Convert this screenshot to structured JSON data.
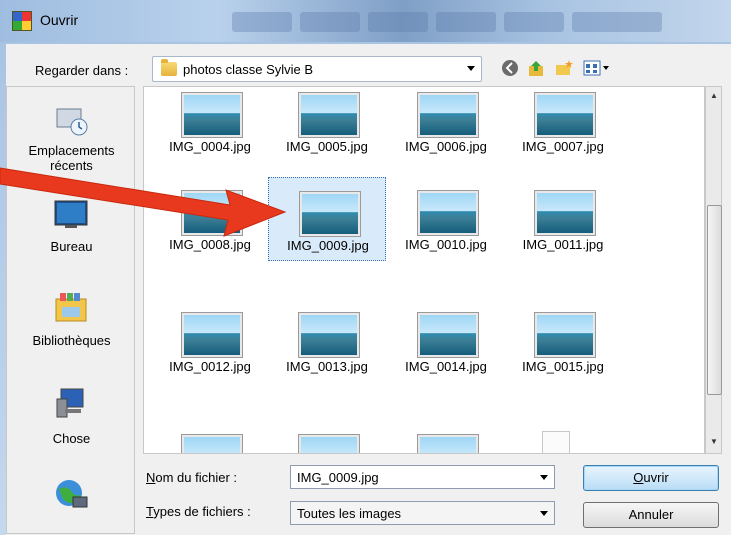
{
  "window": {
    "title": "Ouvrir"
  },
  "toolbar": {
    "lookin_label": "Regarder dans :",
    "lookin_value": "photos classe Sylvie B",
    "buttons": [
      "back-icon",
      "up-folder-icon",
      "new-folder-icon",
      "view-menu-icon"
    ]
  },
  "places": [
    {
      "label": "Emplacements récents",
      "icon": "recent-places-icon"
    },
    {
      "label": "Bureau",
      "icon": "desktop-icon"
    },
    {
      "label": "Bibliothèques",
      "icon": "libraries-icon"
    },
    {
      "label": "Chose",
      "icon": "computer-icon"
    },
    {
      "label": "",
      "icon": "network-icon"
    }
  ],
  "files": [
    {
      "name": "IMG_0004.jpg"
    },
    {
      "name": "IMG_0005.jpg"
    },
    {
      "name": "IMG_0006.jpg"
    },
    {
      "name": "IMG_0007.jpg"
    },
    {
      "name": "IMG_0008.jpg"
    },
    {
      "name": "IMG_0009.jpg",
      "selected": true
    },
    {
      "name": "IMG_0010.jpg"
    },
    {
      "name": "IMG_0011.jpg"
    },
    {
      "name": "IMG_0012.jpg"
    },
    {
      "name": "IMG_0013.jpg"
    },
    {
      "name": "IMG_0014.jpg"
    },
    {
      "name": "IMG_0015.jpg"
    }
  ],
  "form": {
    "filename_label": "Nom du fichier :",
    "filename_value": "IMG_0009.jpg",
    "filetype_label": "Types de fichiers :",
    "filetype_value": "Toutes les images",
    "open_label": "Ouvrir",
    "cancel_label": "Annuler"
  },
  "colors": {
    "annotation_arrow": "#e8391e",
    "selection": "#d9ebfb",
    "accent": "#3c7fb1"
  }
}
